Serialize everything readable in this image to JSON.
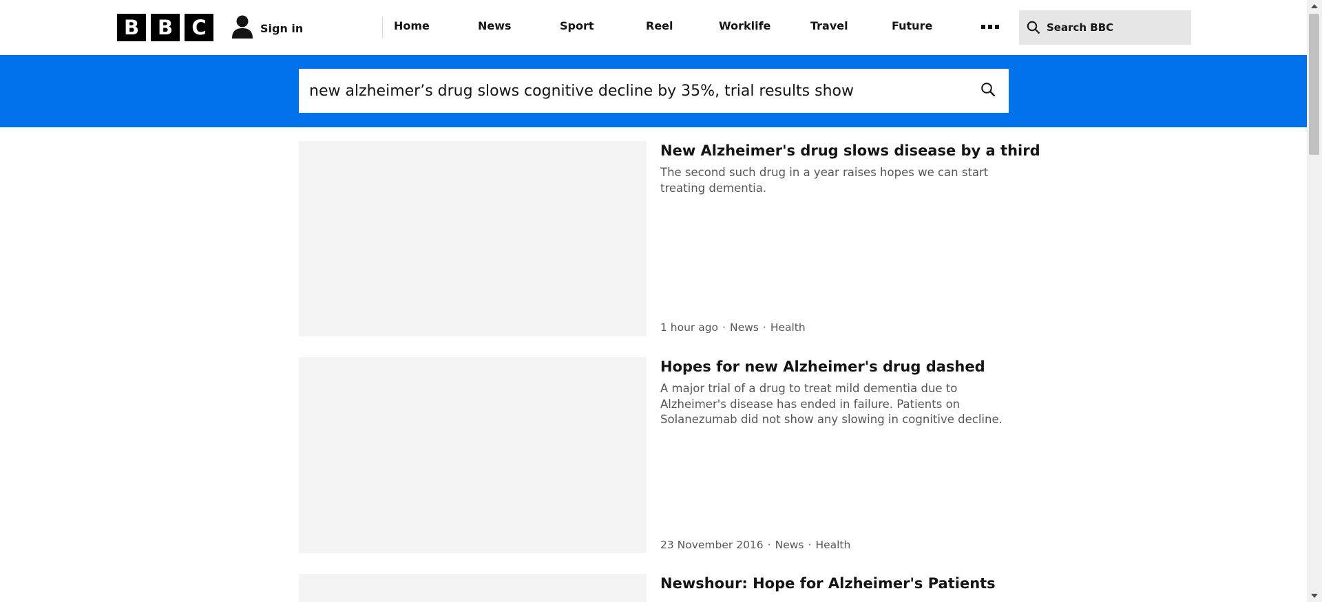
{
  "header": {
    "logo_letters": [
      "B",
      "B",
      "C"
    ],
    "sign_in": "Sign in",
    "nav": [
      "Home",
      "News",
      "Sport",
      "Reel",
      "Worklife",
      "Travel",
      "Future"
    ],
    "search_label": "Search BBC"
  },
  "search": {
    "query": "new alzheimer’s drug slows cognitive decline by 35%, trial results show"
  },
  "results": [
    {
      "title": "New Alzheimer's drug slows disease by a third",
      "description": "The second such drug in a year raises hopes we can start treating dementia.",
      "time": "1 hour ago",
      "section": "News",
      "topic": "Health"
    },
    {
      "title": "Hopes for new Alzheimer's drug dashed",
      "description": "A major trial of a drug to treat mild dementia due to Alzheimer's disease has ended in failure. Patients on Solanezumab did not show any slowing in cognitive decline.",
      "time": "23 November 2016",
      "section": "News",
      "topic": "Health"
    },
    {
      "title": "Newshour: Hope for Alzheimer's Patients"
    }
  ],
  "colors": {
    "band": "#0071eb",
    "thumbnail_placeholder": "#f4f4f4"
  }
}
